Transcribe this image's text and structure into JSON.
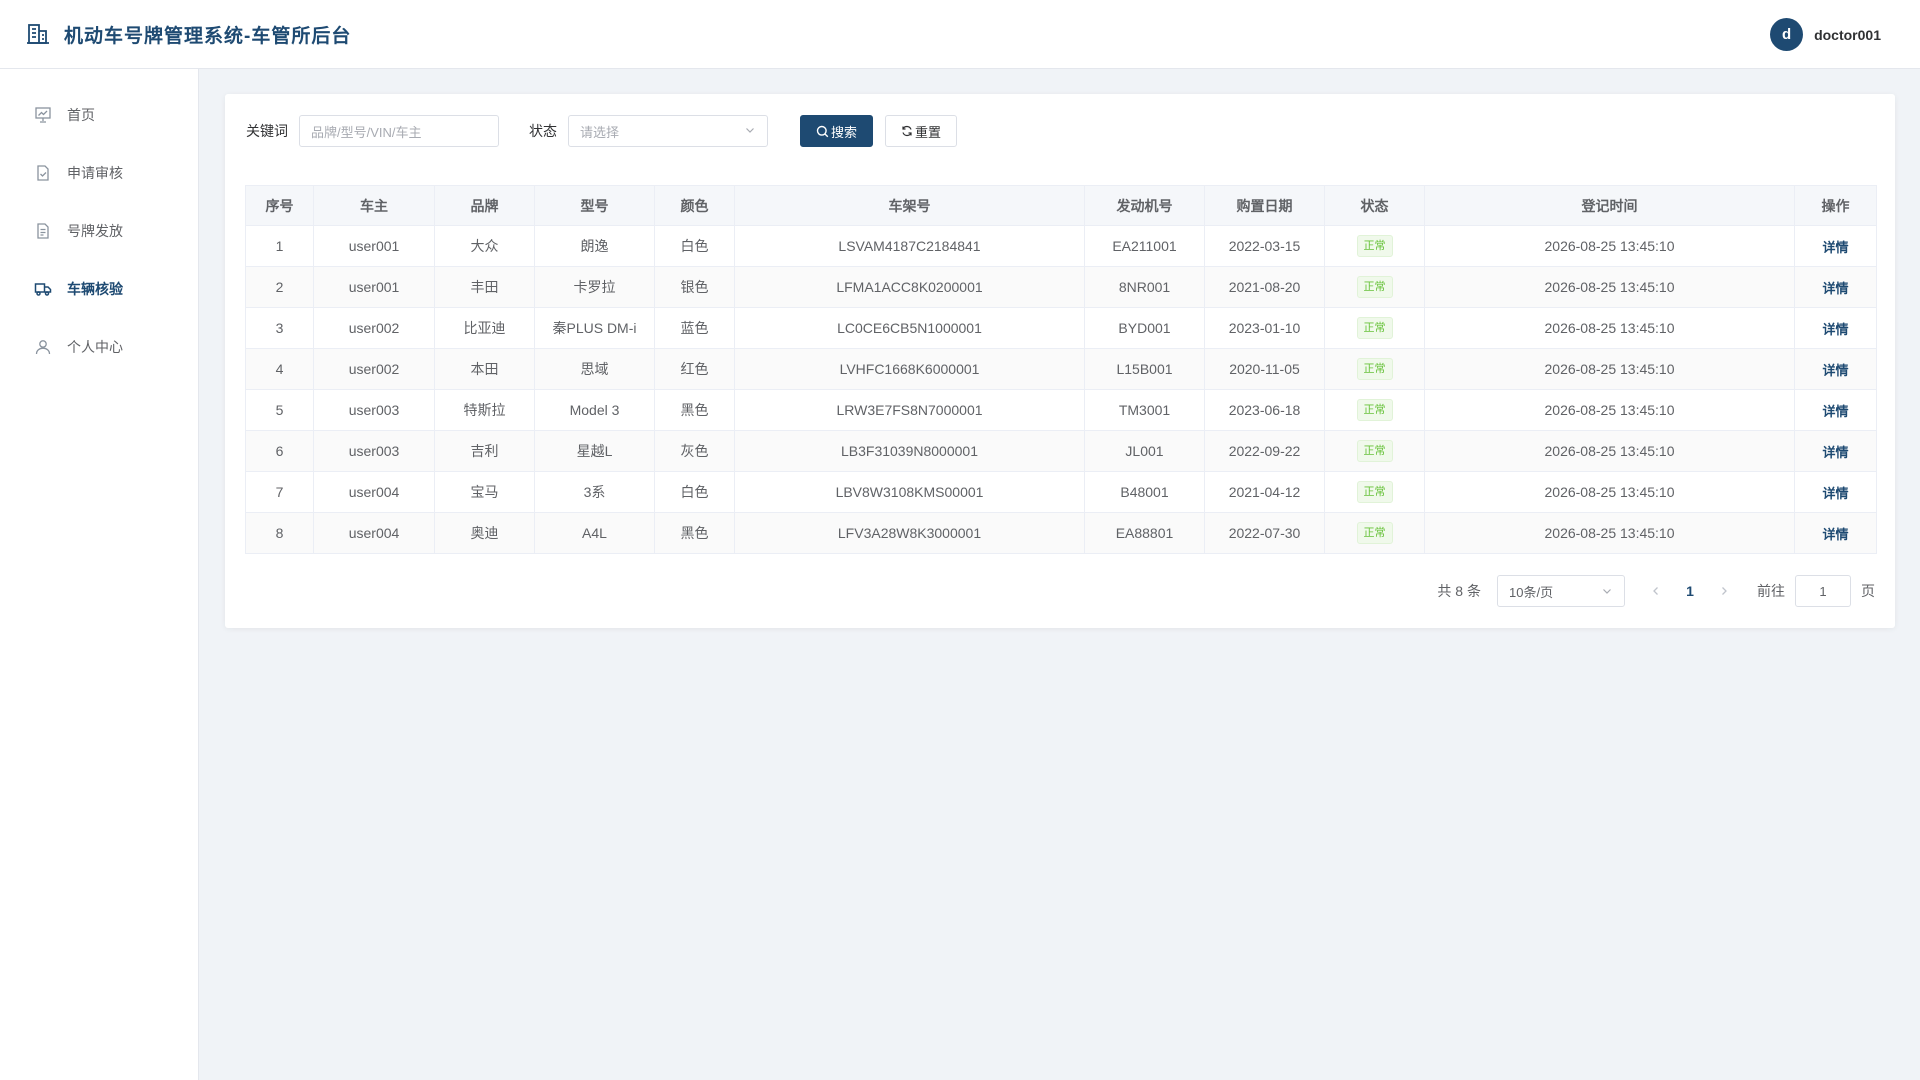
{
  "header": {
    "app_title": "机动车号牌管理系统-车管所后台",
    "avatar_letter": "d",
    "username": "doctor001"
  },
  "sidebar": {
    "items": [
      {
        "label": "首页",
        "icon": "chart-board-icon",
        "active": false
      },
      {
        "label": "申请审核",
        "icon": "document-check-icon",
        "active": false
      },
      {
        "label": "号牌发放",
        "icon": "document-list-icon",
        "active": false
      },
      {
        "label": "车辆核验",
        "icon": "truck-icon",
        "active": true
      },
      {
        "label": "个人中心",
        "icon": "user-icon",
        "active": false
      }
    ]
  },
  "filters": {
    "keyword_label": "关键词",
    "keyword_placeholder": "品牌/型号/VIN/车主",
    "status_label": "状态",
    "status_placeholder": "请选择",
    "search_label": "搜索",
    "reset_label": "重置"
  },
  "table": {
    "columns": [
      "序号",
      "车主",
      "品牌",
      "型号",
      "颜色",
      "车架号",
      "发动机号",
      "购置日期",
      "状态",
      "登记时间",
      "操作"
    ],
    "rows": [
      {
        "no": "1",
        "owner": "user001",
        "brand": "大众",
        "model": "朗逸",
        "color": "白色",
        "vin": "LSVAM4187C2184841",
        "engine": "EA211001",
        "purchase_date": "2022-03-15",
        "status": "正常",
        "registered": "2026-08-25 13:45:10",
        "action": "详情"
      },
      {
        "no": "2",
        "owner": "user001",
        "brand": "丰田",
        "model": "卡罗拉",
        "color": "银色",
        "vin": "LFMA1ACC8K0200001",
        "engine": "8NR001",
        "purchase_date": "2021-08-20",
        "status": "正常",
        "registered": "2026-08-25 13:45:10",
        "action": "详情"
      },
      {
        "no": "3",
        "owner": "user002",
        "brand": "比亚迪",
        "model": "秦PLUS DM-i",
        "color": "蓝色",
        "vin": "LC0CE6CB5N1000001",
        "engine": "BYD001",
        "purchase_date": "2023-01-10",
        "status": "正常",
        "registered": "2026-08-25 13:45:10",
        "action": "详情"
      },
      {
        "no": "4",
        "owner": "user002",
        "brand": "本田",
        "model": "思域",
        "color": "红色",
        "vin": "LVHFC1668K6000001",
        "engine": "L15B001",
        "purchase_date": "2020-11-05",
        "status": "正常",
        "registered": "2026-08-25 13:45:10",
        "action": "详情"
      },
      {
        "no": "5",
        "owner": "user003",
        "brand": "特斯拉",
        "model": "Model 3",
        "color": "黑色",
        "vin": "LRW3E7FS8N7000001",
        "engine": "TM3001",
        "purchase_date": "2023-06-18",
        "status": "正常",
        "registered": "2026-08-25 13:45:10",
        "action": "详情"
      },
      {
        "no": "6",
        "owner": "user003",
        "brand": "吉利",
        "model": "星越L",
        "color": "灰色",
        "vin": "LB3F31039N8000001",
        "engine": "JL001",
        "purchase_date": "2022-09-22",
        "status": "正常",
        "registered": "2026-08-25 13:45:10",
        "action": "详情"
      },
      {
        "no": "7",
        "owner": "user004",
        "brand": "宝马",
        "model": "3系",
        "color": "白色",
        "vin": "LBV8W3108KMS00001",
        "engine": "B48001",
        "purchase_date": "2021-04-12",
        "status": "正常",
        "registered": "2026-08-25 13:45:10",
        "action": "详情"
      },
      {
        "no": "8",
        "owner": "user004",
        "brand": "奥迪",
        "model": "A4L",
        "color": "黑色",
        "vin": "LFV3A28W8K3000001",
        "engine": "EA88801",
        "purchase_date": "2022-07-30",
        "status": "正常",
        "registered": "2026-08-25 13:45:10",
        "action": "详情"
      }
    ]
  },
  "pagination": {
    "total_text": "共 8 条",
    "page_size": "10条/页",
    "current_page": "1",
    "goto_label": "前往",
    "goto_value": "1",
    "page_suffix": "页"
  },
  "colors": {
    "primary": "#1e4a72",
    "success": "#67c23a",
    "background": "#f0f3f7"
  }
}
